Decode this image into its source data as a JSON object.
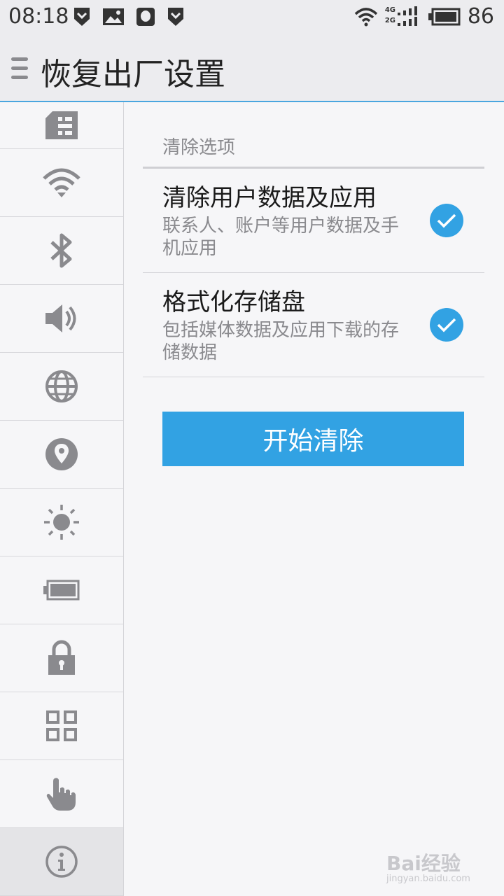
{
  "status_bar": {
    "time": "08:18",
    "battery_level": "86",
    "network_4g": "4G",
    "network_2g": "2G"
  },
  "header": {
    "title": "恢复出厂设置"
  },
  "sidebar": {
    "items": [
      {
        "icon": "sim-card-icon"
      },
      {
        "icon": "wifi-icon"
      },
      {
        "icon": "bluetooth-icon"
      },
      {
        "icon": "speaker-icon"
      },
      {
        "icon": "globe-icon"
      },
      {
        "icon": "location-icon"
      },
      {
        "icon": "brightness-icon"
      },
      {
        "icon": "battery-icon"
      },
      {
        "icon": "lock-icon"
      },
      {
        "icon": "apps-grid-icon"
      },
      {
        "icon": "hand-pointer-icon"
      },
      {
        "icon": "info-icon",
        "active": true
      }
    ]
  },
  "main": {
    "section_title": "清除选项",
    "options": [
      {
        "title": "清除用户数据及应用",
        "description": "联系人、账户等用户数据及手机应用",
        "checked": true
      },
      {
        "title": "格式化存储盘",
        "description": "包括媒体数据及应用下载的存储数据",
        "checked": true
      }
    ],
    "clear_button_label": "开始清除"
  },
  "watermark": {
    "brand": "Bai经验",
    "url": "jingyan.baidu.com"
  },
  "colors": {
    "accent": "#32a2e3",
    "icon_gray": "#8a8a8e",
    "background": "#f6f6f8"
  }
}
